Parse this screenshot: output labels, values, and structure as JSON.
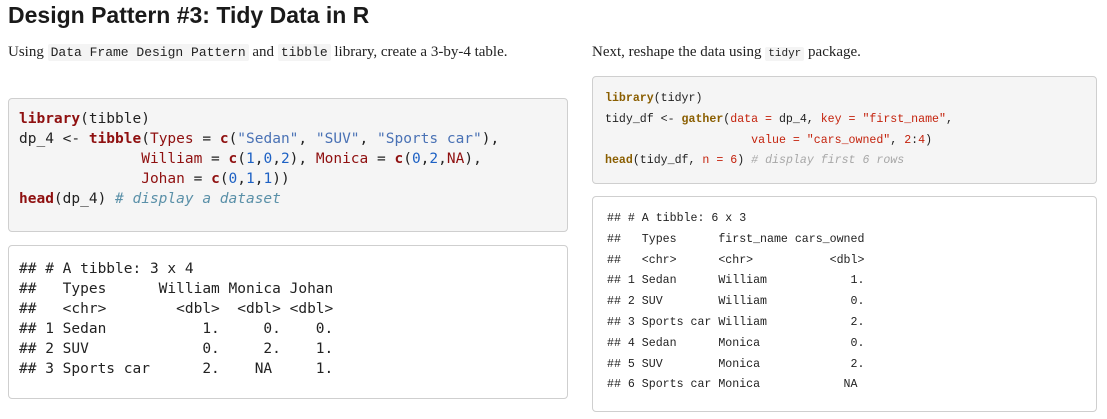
{
  "title": "Design Pattern #3: Tidy Data in R",
  "left": {
    "intro": {
      "pre": "Using ",
      "code1": "Data Frame Design Pattern",
      "mid": " and ",
      "code2": "tibble",
      "post": " library, create a 3-by-4 table."
    },
    "code": {
      "l1_fn": "library",
      "l1_rest": "(tibble)",
      "l2_a": "dp_4 <- ",
      "l2_fn": "tibble",
      "l2_b": "(",
      "l2_arg": "Types",
      "l2_c": " = ",
      "l2_fn2": "c",
      "l2_d": "(",
      "l2_s1": "\"Sedan\"",
      "l2_e": ", ",
      "l2_s2": "\"SUV\"",
      "l2_f": ", ",
      "l2_s3": "\"Sports car\"",
      "l2_g": "),",
      "l3_indent": "              ",
      "l3_arg1": "William",
      "l3_a": " = ",
      "l3_fn1": "c",
      "l3_b": "(",
      "l3_n1": "1",
      "l3_c": ",",
      "l3_n2": "0",
      "l3_d": ",",
      "l3_n3": "2",
      "l3_e": "), ",
      "l3_arg2": "Monica",
      "l3_f": " = ",
      "l3_fn2": "c",
      "l3_g": "(",
      "l3_n4": "0",
      "l3_h": ",",
      "l3_n5": "2",
      "l3_i": ",",
      "l3_na": "NA",
      "l3_j": "),",
      "l4_indent": "              ",
      "l4_arg": "Johan",
      "l4_a": " = ",
      "l4_fn": "c",
      "l4_b": "(",
      "l4_n1": "0",
      "l4_c": ",",
      "l4_n2": "1",
      "l4_d": ",",
      "l4_n3": "1",
      "l4_e": "))",
      "l5_fn": "head",
      "l5_rest": "(dp_4) ",
      "l5_cm": "# display a dataset"
    },
    "output": [
      "## # A tibble: 3 x 4",
      "##   Types      William Monica Johan",
      "##   <chr>        <dbl>  <dbl> <dbl>",
      "## 1 Sedan           1.     0.    0.",
      "## 2 SUV             0.     2.    1.",
      "## 3 Sports car      2.    NA     1."
    ]
  },
  "right": {
    "intro": {
      "pre": "Next, reshape the data using ",
      "code1": "tidyr",
      "post": " package."
    },
    "code": {
      "l1_fn": "library",
      "l1_rest": "(tidyr)",
      "l2_a": "tidy_df <- ",
      "l2_fn": "gather",
      "l2_b": "(",
      "l2_arg1": "data =",
      "l2_c": " dp_4, ",
      "l2_arg2": "key =",
      "l2_d": " ",
      "l2_s1": "\"first_name\"",
      "l2_e": ",",
      "l3_indent": "                     ",
      "l3_arg": "value =",
      "l3_a": " ",
      "l3_s": "\"cars_owned\"",
      "l3_b": ", ",
      "l3_n": "2",
      "l3_c": ":",
      "l3_n2": "4",
      "l3_d": ")",
      "l4_fn": "head",
      "l4_a": "(tidy_df, ",
      "l4_arg": "n =",
      "l4_b": " ",
      "l4_n": "6",
      "l4_c": ") ",
      "l4_cm": "# display first 6 rows"
    },
    "output": [
      "## # A tibble: 6 x 3",
      "##   Types      first_name cars_owned",
      "##   <chr>      <chr>           <dbl>",
      "## 1 Sedan      William            1.",
      "## 2 SUV        William            0.",
      "## 3 Sports car William            2.",
      "## 4 Sedan      Monica             0.",
      "## 5 SUV        Monica             2.",
      "## 6 Sports car Monica            NA"
    ]
  }
}
